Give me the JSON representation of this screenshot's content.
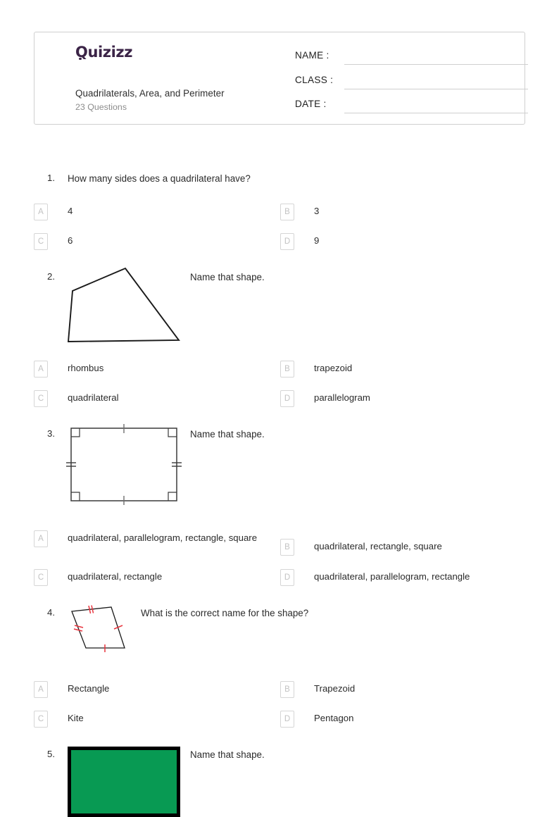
{
  "header": {
    "logo_text": "Quizizz",
    "logo_color": "#3b2447",
    "title": "Quadrilaterals, Area, and Perimeter",
    "question_count": "23 Questions",
    "fields": [
      {
        "label": "NAME :"
      },
      {
        "label": "CLASS :"
      },
      {
        "label": "DATE  :"
      }
    ]
  },
  "questions": [
    {
      "number": "1.",
      "text": "How many sides does a quadrilateral have?",
      "figure": "none",
      "options": [
        {
          "letter": "A",
          "text": "4"
        },
        {
          "letter": "B",
          "text": "3"
        },
        {
          "letter": "C",
          "text": "6"
        },
        {
          "letter": "D",
          "text": "9"
        }
      ]
    },
    {
      "number": "2.",
      "text": "Name that shape.",
      "figure": "irregular-quadrilateral",
      "options": [
        {
          "letter": "A",
          "text": "rhombus"
        },
        {
          "letter": "B",
          "text": "trapezoid"
        },
        {
          "letter": "C",
          "text": "quadrilateral"
        },
        {
          "letter": "D",
          "text": "parallelogram"
        }
      ]
    },
    {
      "number": "3.",
      "text": "Name that shape.",
      "figure": "rectangle-with-marks",
      "options": [
        {
          "letter": "A",
          "text": "quadrilateral, parallelogram, rectangle, square"
        },
        {
          "letter": "B",
          "text": "quadrilateral, rectangle, square"
        },
        {
          "letter": "C",
          "text": "quadrilateral, rectangle"
        },
        {
          "letter": "D",
          "text": "quadrilateral, parallelogram, rectangle"
        }
      ]
    },
    {
      "number": "4.",
      "text": "What is the correct name for the shape?",
      "figure": "kite-with-red-marks",
      "options": [
        {
          "letter": "A",
          "text": "Rectangle"
        },
        {
          "letter": "B",
          "text": "Trapezoid"
        },
        {
          "letter": "C",
          "text": "Kite"
        },
        {
          "letter": "D",
          "text": "Pentagon"
        }
      ]
    },
    {
      "number": "5.",
      "text": "Name that shape.",
      "figure": "green-rectangle",
      "options": []
    }
  ],
  "colors": {
    "green_shape": "#089a53",
    "red_marks": "#e8323c",
    "shape_outline": "#1a1a1a",
    "badge_border": "#d6d6d6",
    "muted_text": "#8d8d8d"
  }
}
